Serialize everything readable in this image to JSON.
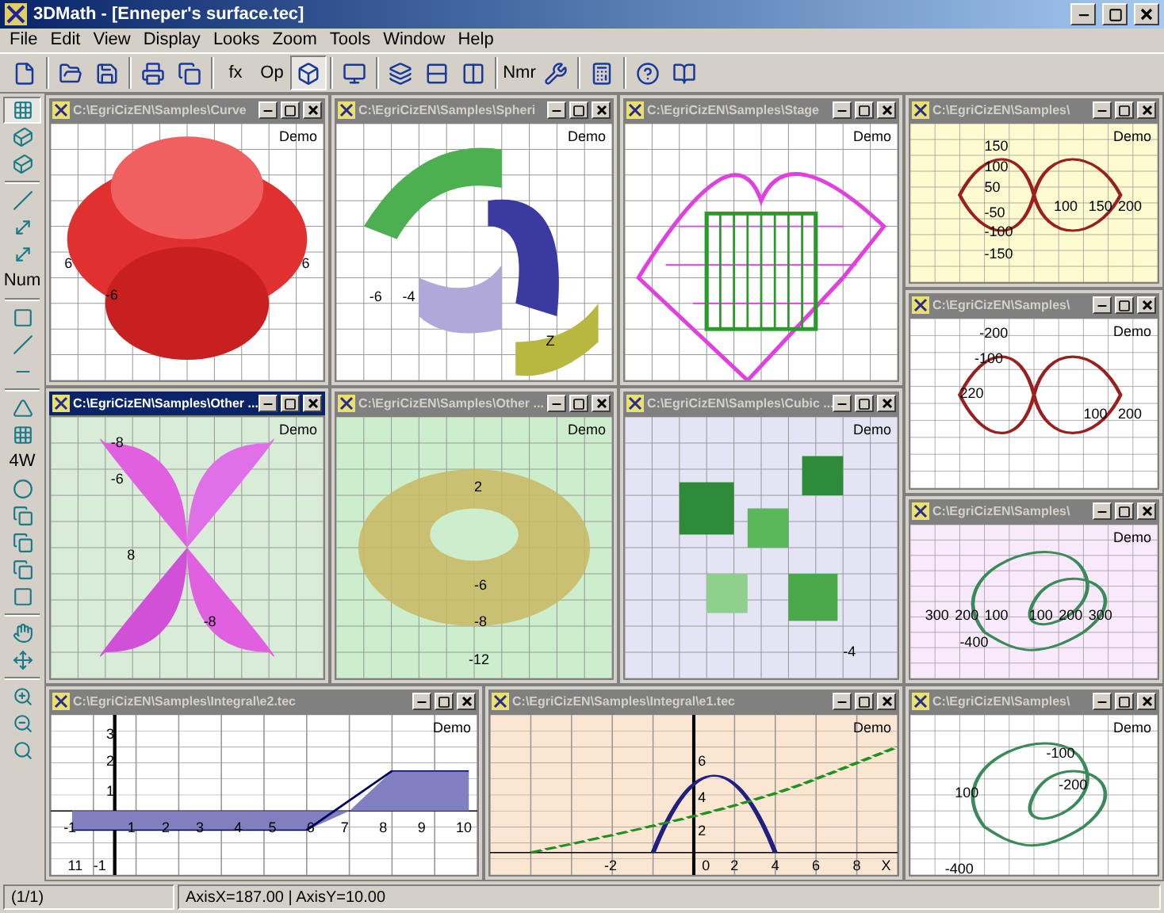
{
  "window": {
    "title": "3DMath - [Enneper's surface.tec]"
  },
  "menu": [
    "File",
    "Edit",
    "View",
    "Display",
    "Looks",
    "Zoom",
    "Tools",
    "Window",
    "Help"
  ],
  "toolbar": [
    {
      "kind": "icon",
      "selected": false
    },
    {
      "kind": "sep"
    },
    {
      "kind": "icon",
      "selected": false
    },
    {
      "kind": "icon",
      "selected": false
    },
    {
      "kind": "sep"
    },
    {
      "kind": "icon",
      "selected": false
    },
    {
      "kind": "icon",
      "selected": false
    },
    {
      "kind": "sep"
    },
    {
      "kind": "text",
      "label": "fx",
      "selected": false
    },
    {
      "kind": "text",
      "label": "Op",
      "selected": false
    },
    {
      "kind": "icon",
      "selected": true
    },
    {
      "kind": "sep"
    },
    {
      "kind": "icon",
      "selected": false
    },
    {
      "kind": "sep"
    },
    {
      "kind": "icon",
      "selected": false
    },
    {
      "kind": "icon",
      "selected": false
    },
    {
      "kind": "icon",
      "selected": false
    },
    {
      "kind": "sep"
    },
    {
      "kind": "text",
      "label": "Nmr",
      "selected": false
    },
    {
      "kind": "icon",
      "selected": false
    },
    {
      "kind": "sep"
    },
    {
      "kind": "icon",
      "selected": false
    },
    {
      "kind": "sep"
    },
    {
      "kind": "icon",
      "selected": false
    },
    {
      "kind": "icon",
      "selected": false
    }
  ],
  "side_toolbar": [
    {
      "kind": "icon",
      "selected": true
    },
    {
      "kind": "icon",
      "selected": false
    },
    {
      "kind": "icon",
      "selected": false
    },
    {
      "kind": "sep"
    },
    {
      "kind": "icon",
      "selected": false
    },
    {
      "kind": "icon",
      "selected": false
    },
    {
      "kind": "icon",
      "selected": false
    },
    {
      "kind": "text",
      "label": "Num",
      "selected": false
    },
    {
      "kind": "sep"
    },
    {
      "kind": "icon",
      "selected": false
    },
    {
      "kind": "icon",
      "selected": false
    },
    {
      "kind": "icon",
      "selected": false
    },
    {
      "kind": "sep"
    },
    {
      "kind": "icon",
      "selected": false
    },
    {
      "kind": "icon",
      "selected": false
    },
    {
      "kind": "text",
      "label": "4W",
      "selected": false
    },
    {
      "kind": "icon",
      "selected": false
    },
    {
      "kind": "icon",
      "selected": false
    },
    {
      "kind": "icon",
      "selected": false
    },
    {
      "kind": "icon",
      "selected": false
    },
    {
      "kind": "icon",
      "selected": false
    },
    {
      "kind": "sep"
    },
    {
      "kind": "icon",
      "selected": false
    },
    {
      "kind": "icon",
      "selected": false
    },
    {
      "kind": "sep"
    },
    {
      "kind": "icon",
      "selected": false
    },
    {
      "kind": "icon",
      "selected": false
    },
    {
      "kind": "icon",
      "selected": false
    }
  ],
  "documents": [
    {
      "title": "C:\\EgriCizEN\\Samples\\Curve",
      "active": false,
      "badge": "Demo",
      "kind": "surface",
      "color": "#ffffff",
      "labels": [
        "6",
        "-6",
        "6"
      ]
    },
    {
      "title": "C:\\EgriCizEN\\Samples\\Spheri",
      "active": false,
      "badge": "Demo",
      "kind": "spheres",
      "color": "#ffffff",
      "labels": [
        "-6",
        "-4",
        "Z"
      ]
    },
    {
      "title": "C:\\EgriCizEN\\Samples\\Stage",
      "active": false,
      "badge": "Demo",
      "kind": "wire",
      "color": "#ffffff"
    },
    {
      "title": "C:\\EgriCizEN\\Samples\\",
      "active": false,
      "badge": "Demo",
      "kind": "curve",
      "color": "#fffbd0",
      "labels": [
        "150",
        "100",
        "50",
        "-50",
        "-100",
        "-150",
        "100",
        "150",
        "200"
      ]
    },
    {
      "title": "C:\\EgriCizEN\\Samples\\",
      "active": false,
      "badge": "Demo",
      "kind": "curve",
      "color": "#ffffff",
      "labels": [
        "-200",
        "-100",
        "220",
        "100",
        "200"
      ]
    },
    {
      "title": "C:\\EgriCizEN\\Samples\\",
      "active": false,
      "badge": "Demo",
      "kind": "knot",
      "color": "#f8eafa",
      "labels": [
        "300",
        "200",
        "100",
        "100",
        "200",
        "300",
        "-400"
      ]
    },
    {
      "title": "C:\\EgriCizEN\\Samples\\Other ...",
      "active": true,
      "badge": "Demo",
      "kind": "petals",
      "color": "#d8ecd8",
      "labels": [
        "-8",
        "-6",
        "8",
        "-8"
      ]
    },
    {
      "title": "C:\\EgriCizEN\\Samples\\Other ...",
      "active": false,
      "badge": "Demo",
      "kind": "torus",
      "color": "#cdeecd",
      "labels": [
        "2",
        "-6",
        "-8",
        "-12"
      ]
    },
    {
      "title": "C:\\EgriCizEN\\Samples\\Cubic ...",
      "active": false,
      "badge": "Demo",
      "kind": "cubes",
      "color": "#e4e4f4",
      "labels": [
        "-4"
      ]
    },
    {
      "title": "C:\\EgriCizEN\\Samples\\Integral\\e2.tec",
      "active": false,
      "badge": "Demo",
      "kind": "integral",
      "color": "#ffffff",
      "labels": [
        "3",
        "2",
        "1",
        "-1",
        "1",
        "2",
        "3",
        "4",
        "5",
        "6",
        "7",
        "8",
        "9",
        "10",
        "11",
        "-1"
      ]
    },
    {
      "title": "C:\\EgriCizEN\\Samples\\Integral\\e1.tec",
      "active": false,
      "badge": "Demo",
      "kind": "wave",
      "color": "#fbe6d2",
      "labels": [
        "6",
        "4",
        "2",
        "-2",
        "0",
        "2",
        "4",
        "6",
        "8",
        "X"
      ]
    },
    {
      "title": "C:\\EgriCizEN\\Samples\\",
      "active": false,
      "badge": "Demo",
      "kind": "knot",
      "color": "#ffffff",
      "labels": [
        "100",
        "-100",
        "-200",
        "-400"
      ]
    }
  ],
  "status_bar": [
    "(1/1)",
    "AxisX=187.00 | AxisY=10.00"
  ]
}
